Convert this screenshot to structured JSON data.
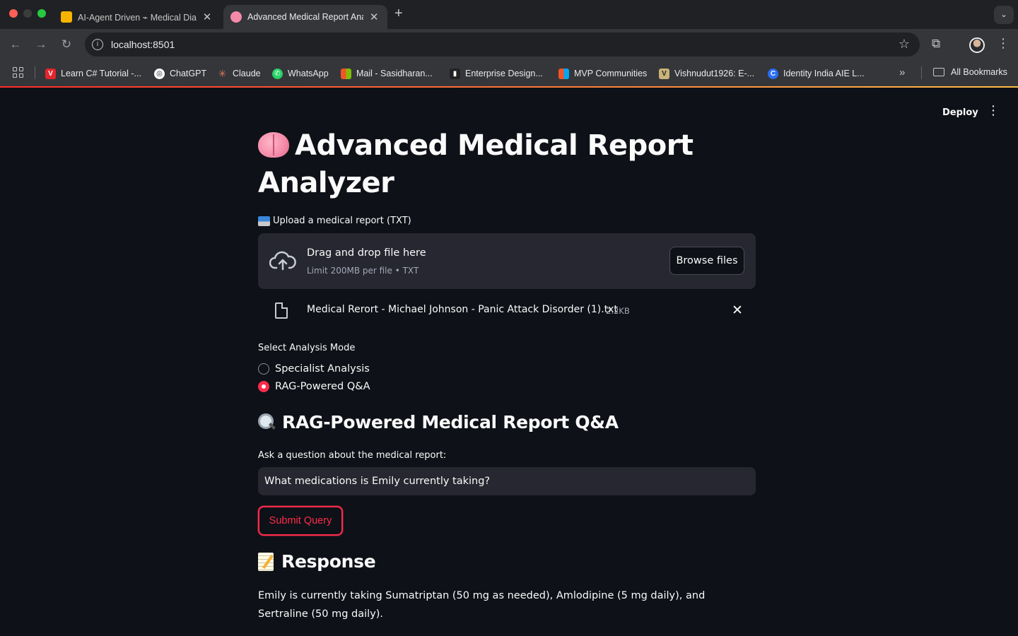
{
  "browser": {
    "tabs": [
      {
        "title": "AI-Agent Driven ⌁ Medical Dia",
        "favicon_color": "#f6b400"
      },
      {
        "title": "Advanced Medical Report Ana",
        "favicon_color": "#f48aa8",
        "active": true
      }
    ],
    "new_tab": "+",
    "url": "localhost:8501",
    "bookmarks": [
      {
        "label": "Learn C# Tutorial -...",
        "icon_color": "#e3262f",
        "icon": "V"
      },
      {
        "label": "ChatGPT",
        "icon_color": "#ffffff",
        "icon": "◎"
      },
      {
        "label": "Claude",
        "icon_color": "#d97757",
        "icon": "✳"
      },
      {
        "label": "WhatsApp",
        "icon_color": "#25d366",
        "icon": "✆"
      },
      {
        "label": "Mail - Sasidharan...",
        "icon_color": "#f35325",
        "icon": "▦"
      },
      {
        "label": "Enterprise Design...",
        "icon_color": "#222222",
        "icon": "▮"
      },
      {
        "label": "MVP Communities",
        "icon_color": "#f35325",
        "icon": "▦"
      },
      {
        "label": "Vishnudut1926: E-...",
        "icon_color": "#c9b37a",
        "icon": "V"
      },
      {
        "label": "Identity India AIE L...",
        "icon_color": "#2a6df4",
        "icon": "C"
      }
    ],
    "bookmarks_more": "»",
    "all_bookmarks": "All Bookmarks"
  },
  "app": {
    "header": {
      "deploy": "Deploy",
      "menu_icon": "⋮"
    },
    "title": "Advanced Medical Report Analyzer",
    "uploader": {
      "label": "Upload a medical report (TXT)",
      "drop_title": "Drag and drop file here",
      "limit": "Limit 200MB per file • TXT",
      "browse": "Browse files",
      "file_name": "Medical Rerort - Michael Johnson - Panic Attack Disorder (1).txt",
      "file_size": "2.2KB",
      "remove": "✕"
    },
    "mode": {
      "label": "Select Analysis Mode",
      "options": [
        "Specialist Analysis",
        "RAG-Powered Q&A"
      ],
      "selected": "RAG-Powered Q&A"
    },
    "qa": {
      "heading": "RAG-Powered Medical Report Q&A",
      "label": "Ask a question about the medical report:",
      "question": "What medications is Emily currently taking?",
      "submit": "Submit Query"
    },
    "response": {
      "heading": "Response",
      "text": "Emily is currently taking Sumatriptan (50 mg as needed), Amlodipine (5 mg daily), and Sertraline (50 mg daily)."
    },
    "colors": {
      "accent": "#ff2b4b",
      "background": "#0e1117",
      "surface": "#262730"
    }
  }
}
